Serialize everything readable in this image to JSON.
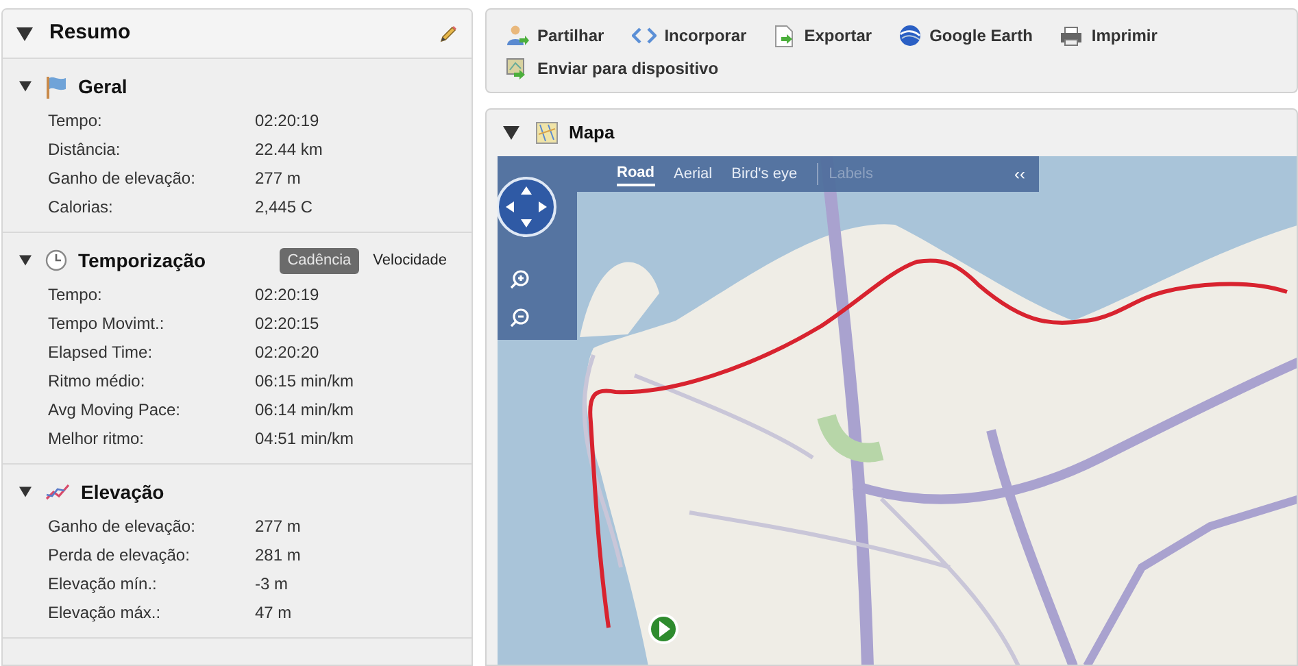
{
  "summary": {
    "title": "Resumo",
    "expanded": true,
    "sections": [
      {
        "kind": "flag",
        "title": "Geral",
        "expanded": true,
        "rows": [
          {
            "label": "Tempo:",
            "value": "02:20:19"
          },
          {
            "label": "Distância:",
            "value": "22.44 km"
          },
          {
            "label": "Ganho de elevação:",
            "value": "277 m"
          },
          {
            "label": "Calorias:",
            "value": "2,445 C"
          }
        ]
      },
      {
        "kind": "clock",
        "title": "Temporização",
        "expanded": true,
        "toggle": [
          {
            "label": "Cadência",
            "selected": true
          },
          {
            "label": "Velocidade",
            "selected": false
          }
        ],
        "rows": [
          {
            "label": "Tempo:",
            "value": "02:20:19"
          },
          {
            "label": "Tempo Movimt.:",
            "value": "02:20:15"
          },
          {
            "label": "Elapsed Time:",
            "value": "02:20:20"
          },
          {
            "label": "Ritmo médio:",
            "value": "06:15 min/km"
          },
          {
            "label": "Avg Moving Pace:",
            "value": "06:14 min/km"
          },
          {
            "label": "Melhor ritmo:",
            "value": "04:51 min/km"
          }
        ]
      },
      {
        "kind": "chart",
        "title": "Elevação",
        "expanded": true,
        "rows": [
          {
            "label": "Ganho de elevação:",
            "value": "277 m"
          },
          {
            "label": "Perda de elevação:",
            "value": "281 m"
          },
          {
            "label": "Elevação mín.:",
            "value": "-3 m"
          },
          {
            "label": "Elevação máx.:",
            "value": "47 m"
          }
        ]
      }
    ]
  },
  "toolbar": [
    {
      "kind": "share",
      "label": "Partilhar"
    },
    {
      "kind": "embed",
      "label": "Incorporar"
    },
    {
      "kind": "export",
      "label": "Exportar"
    },
    {
      "kind": "earth",
      "label": "Google Earth"
    },
    {
      "kind": "print",
      "label": "Imprimir"
    },
    {
      "kind": "device",
      "label": "Enviar para dispositivo"
    }
  ],
  "map": {
    "title": "Mapa",
    "expanded": true,
    "view_tabs": [
      {
        "label": "Road",
        "selected": true,
        "disabled": false
      },
      {
        "label": "Aerial",
        "selected": false,
        "disabled": false
      },
      {
        "label": "Bird's eye",
        "selected": false,
        "disabled": false
      },
      {
        "label": "Labels",
        "selected": false,
        "disabled": true
      }
    ],
    "collapse": "‹‹"
  }
}
